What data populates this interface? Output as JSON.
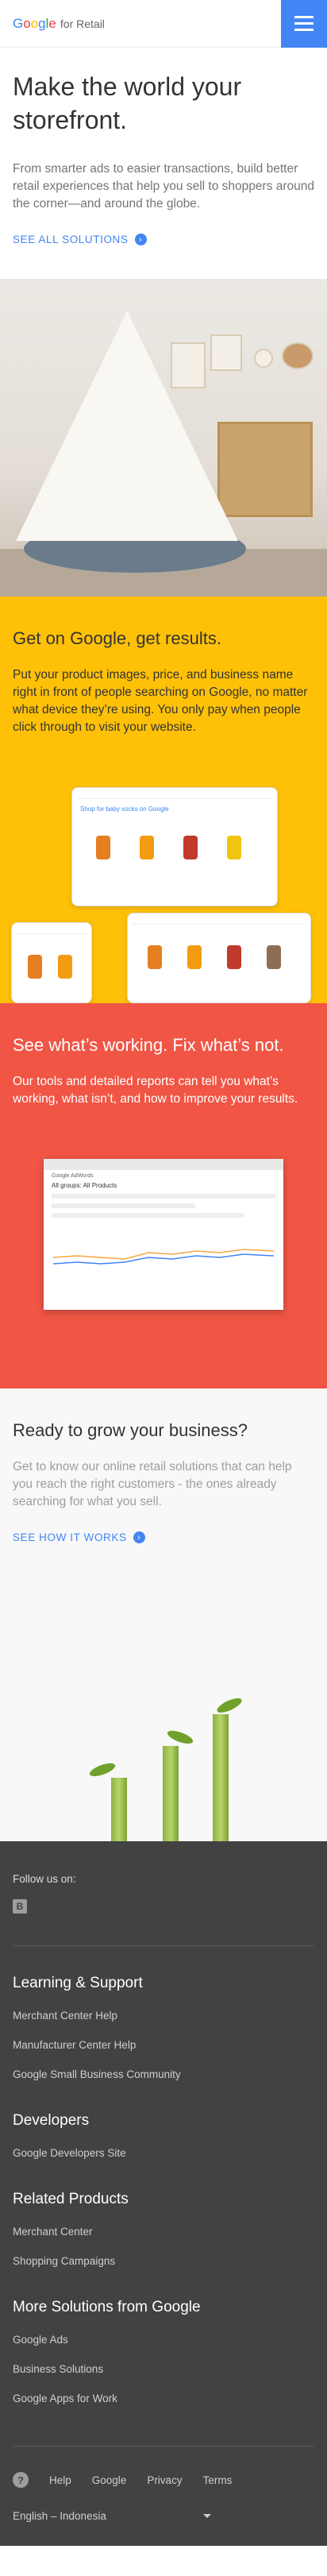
{
  "header": {
    "logo_letters": [
      "G",
      "o",
      "o",
      "g",
      "l",
      "e"
    ],
    "logo_suffix": "for Retail"
  },
  "hero": {
    "title": "Make the world your storefront.",
    "body": "From smarter ads to easier transactions, build better retail experiences that help you sell to shoppers around the corner—and around the globe.",
    "cta": "SEE ALL SOLUTIONS"
  },
  "yellow": {
    "title": "Get on Google, get results.",
    "body": "Put your product images, price, and business name right in front of people searching on Google, no matter what device they’re using. You only pay when people click through to visit your website.",
    "device_text": "Shop for baby socks on Google",
    "bg_color": "#ffc107"
  },
  "red": {
    "title": "See what’s working. Fix what’s not.",
    "body": "Our tools and detailed reports can tell you what’s working, what isn’t, and how to improve your results.",
    "screenshot_title": "Google AdWords",
    "screenshot_group": "All groups: All Products",
    "bg_color": "#f05545"
  },
  "grow": {
    "title": "Ready to grow your business?",
    "body": "Get to know our online retail solutions that can help you reach the right customers - the ones already searching for what you sell.",
    "cta": "SEE HOW IT WORKS"
  },
  "footer": {
    "follow": "Follow us on:",
    "social_icon": "blogger-icon",
    "sections": [
      {
        "title": "Learning & Support",
        "links": [
          "Merchant Center Help",
          "Manufacturer Center Help",
          "Google Small Business Community"
        ]
      },
      {
        "title": "Developers",
        "links": [
          "Google Developers Site"
        ]
      },
      {
        "title": "Related Products",
        "links": [
          "Merchant Center",
          "Shopping Campaigns"
        ]
      },
      {
        "title": "More Solutions from Google",
        "links": [
          "Google Ads",
          "Business Solutions",
          "Google Apps for Work"
        ]
      }
    ],
    "bottom": {
      "help": "Help",
      "google": "Google",
      "privacy": "Privacy",
      "terms": "Terms"
    },
    "language": "English – Indonesia"
  }
}
